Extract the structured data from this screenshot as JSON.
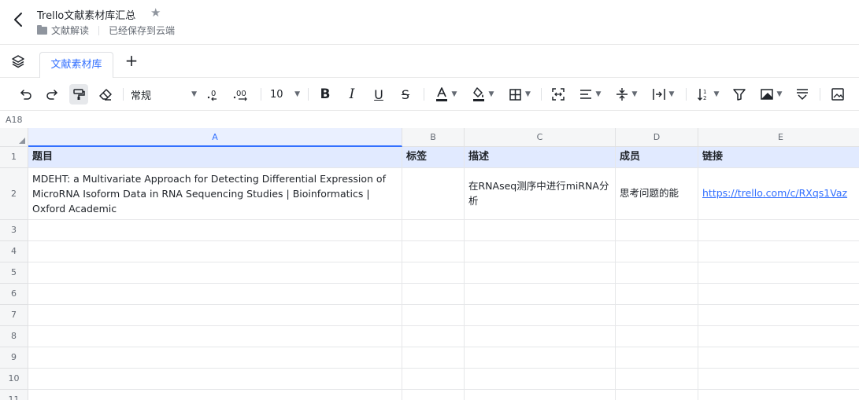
{
  "header": {
    "title": "Trello文献素材库汇总",
    "breadcrumb_folder": "文献解读",
    "save_status": "已经保存到云端"
  },
  "tabs": [
    {
      "label": "文献素材库",
      "active": true
    }
  ],
  "toolbar": {
    "number_format": "常规",
    "font_size": "10",
    "accent_color": "#3370ff"
  },
  "cell_ref": "A18",
  "columns": [
    "A",
    "B",
    "C",
    "D",
    "E"
  ],
  "row_numbers": [
    "1",
    "2",
    "3",
    "4",
    "5",
    "6",
    "7",
    "8",
    "9",
    "10",
    "11"
  ],
  "table": {
    "headers": [
      "题目",
      "标签",
      "描述",
      "成员",
      "链接"
    ],
    "row2": {
      "title": "MDEHT: a Multivariate Approach for Detecting Differential Expression of MicroRNA Isoform Data in RNA Sequencing Studies | Bioinformatics | Oxford Academic",
      "tag": "",
      "description": "在RNAseq测序中进行miRNA分析",
      "member": "思考问题的能",
      "link": "https://trello.com/c/RXqs1Vaz"
    }
  }
}
